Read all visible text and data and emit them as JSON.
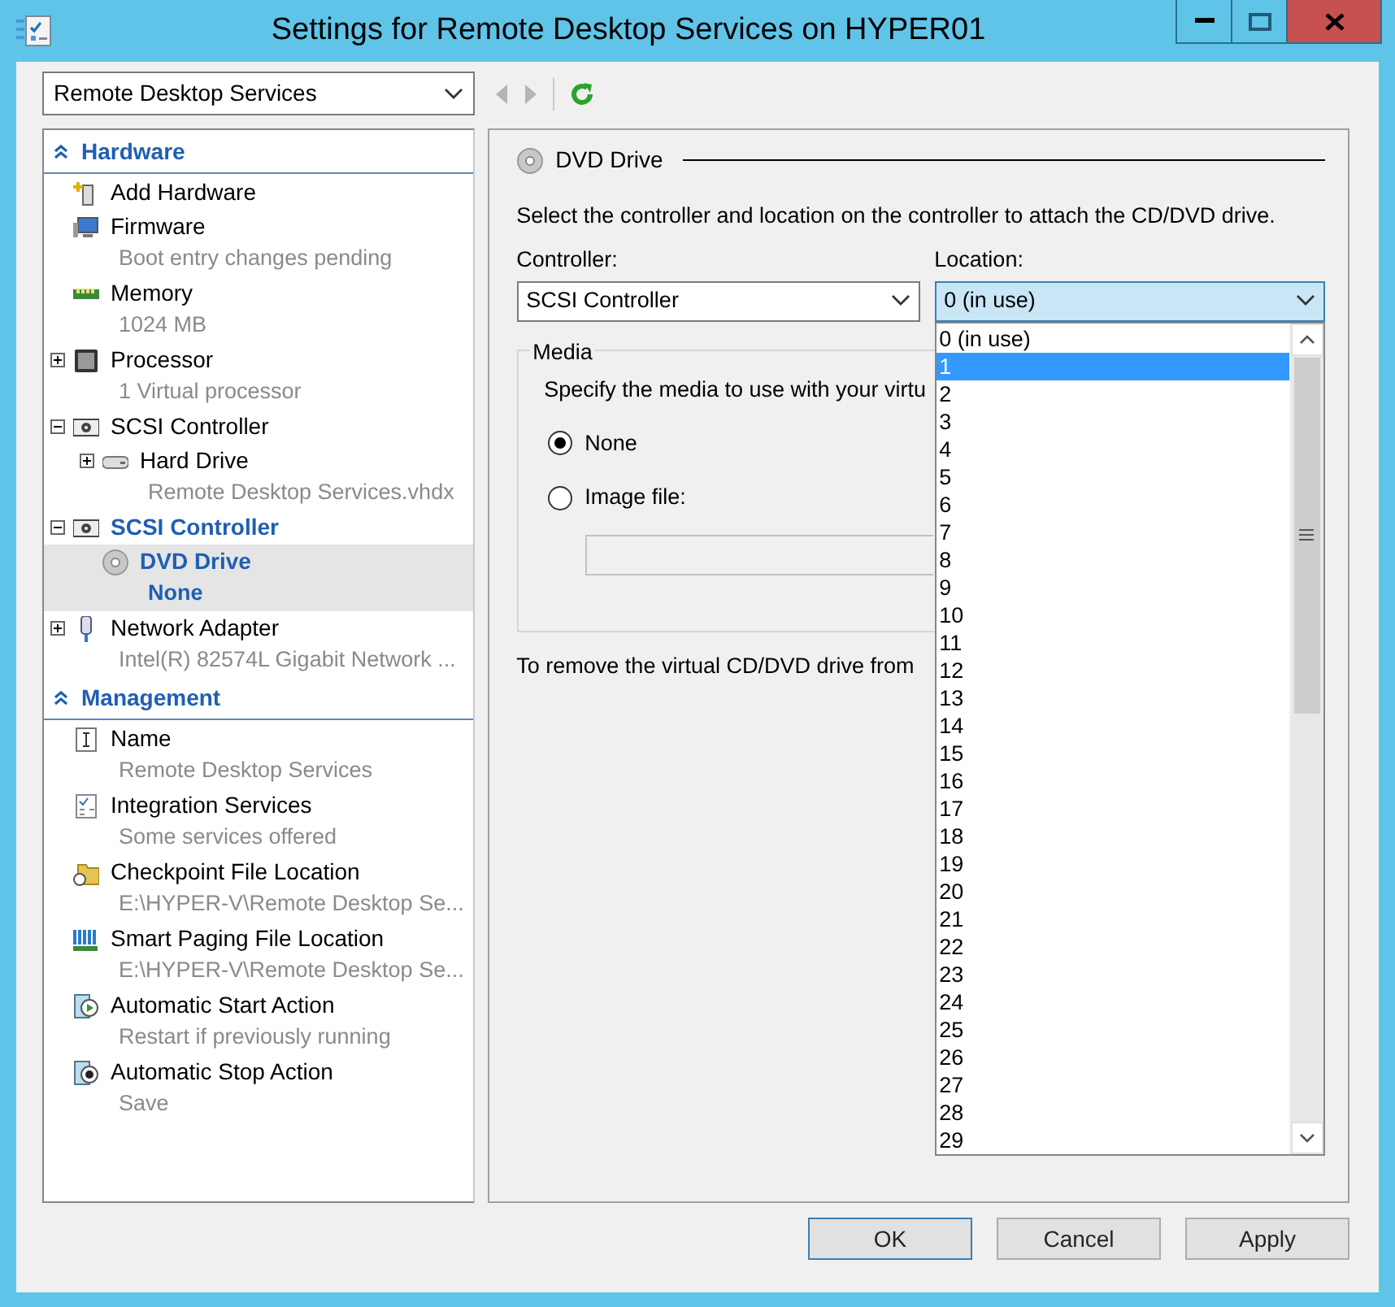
{
  "window": {
    "title": "Settings for Remote Desktop Services on HYPER01"
  },
  "vm_selector": {
    "value": "Remote Desktop Services"
  },
  "toolbar": [
    {
      "kind": "back",
      "disabled": true
    },
    {
      "kind": "forward",
      "disabled": true
    },
    {
      "kind": "refresh",
      "disabled": false
    }
  ],
  "tree": {
    "sections": [
      {
        "title": "Hardware",
        "expanded": true,
        "items": [
          {
            "title": "Add Hardware",
            "kind": "add",
            "selected": false
          },
          {
            "title": "Firmware",
            "subtitle": "Boot entry changes pending",
            "kind": "firmware",
            "selected": false
          },
          {
            "title": "Memory",
            "subtitle": "1024 MB",
            "kind": "memory",
            "selected": false
          },
          {
            "title": "Processor",
            "subtitle": "1 Virtual processor",
            "kind": "processor",
            "expanded": false,
            "selected": false
          },
          {
            "title": "SCSI Controller",
            "kind": "controller",
            "expanded": true,
            "selected": false,
            "children": [
              {
                "title": "Hard Drive",
                "subtitle": "Remote Desktop Services.vhdx",
                "kind": "disk",
                "expanded": false,
                "selected": false
              }
            ]
          },
          {
            "title": "SCSI Controller",
            "kind": "controller",
            "expanded": true,
            "selected": false,
            "children": [
              {
                "title": "DVD Drive",
                "subtitle": "None",
                "kind": "dvd",
                "selected": true
              }
            ]
          },
          {
            "title": "Network Adapter",
            "subtitle": "Intel(R) 82574L Gigabit Network ...",
            "kind": "network",
            "expanded": false,
            "selected": false
          }
        ]
      },
      {
        "title": "Management",
        "expanded": true,
        "items": [
          {
            "title": "Name",
            "subtitle": "Remote Desktop Services",
            "kind": "name",
            "selected": false
          },
          {
            "title": "Integration Services",
            "subtitle": "Some services offered",
            "kind": "integration",
            "selected": false
          },
          {
            "title": "Checkpoint File Location",
            "subtitle": "E:\\HYPER-V\\Remote Desktop Se...",
            "kind": "checkpoint",
            "selected": false
          },
          {
            "title": "Smart Paging File Location",
            "subtitle": "E:\\HYPER-V\\Remote Desktop Se...",
            "kind": "paging",
            "selected": false
          },
          {
            "title": "Automatic Start Action",
            "subtitle": "Restart if previously running",
            "kind": "start",
            "selected": false
          },
          {
            "title": "Automatic Stop Action",
            "subtitle": "Save",
            "kind": "stop",
            "selected": false
          }
        ]
      }
    ]
  },
  "panel": {
    "title": "DVD Drive",
    "intro": "Select the controller and location on the controller to attach the CD/DVD drive.",
    "controller": {
      "label": "Controller:",
      "value": "SCSI Controller"
    },
    "location": {
      "label": "Location:",
      "value": "0 (in use)",
      "expanded": true,
      "options": [
        {
          "label": "0 (in use)",
          "highlighted": false
        },
        {
          "label": "1",
          "highlighted": true
        },
        {
          "label": "2",
          "highlighted": false
        },
        {
          "label": "3",
          "highlighted": false
        },
        {
          "label": "4",
          "highlighted": false
        },
        {
          "label": "5",
          "highlighted": false
        },
        {
          "label": "6",
          "highlighted": false
        },
        {
          "label": "7",
          "highlighted": false
        },
        {
          "label": "8",
          "highlighted": false
        },
        {
          "label": "9",
          "highlighted": false
        },
        {
          "label": "10",
          "highlighted": false
        },
        {
          "label": "11",
          "highlighted": false
        },
        {
          "label": "12",
          "highlighted": false
        },
        {
          "label": "13",
          "highlighted": false
        },
        {
          "label": "14",
          "highlighted": false
        },
        {
          "label": "15",
          "highlighted": false
        },
        {
          "label": "16",
          "highlighted": false
        },
        {
          "label": "17",
          "highlighted": false
        },
        {
          "label": "18",
          "highlighted": false
        },
        {
          "label": "19",
          "highlighted": false
        },
        {
          "label": "20",
          "highlighted": false
        },
        {
          "label": "21",
          "highlighted": false
        },
        {
          "label": "22",
          "highlighted": false
        },
        {
          "label": "23",
          "highlighted": false
        },
        {
          "label": "24",
          "highlighted": false
        },
        {
          "label": "25",
          "highlighted": false
        },
        {
          "label": "26",
          "highlighted": false
        },
        {
          "label": "27",
          "highlighted": false
        },
        {
          "label": "28",
          "highlighted": false
        },
        {
          "label": "29",
          "highlighted": false
        }
      ]
    },
    "media": {
      "title": "Media",
      "instruction": "Specify the media to use with your virtu",
      "options": [
        {
          "label": "None",
          "selected": true
        },
        {
          "label": "Image file:",
          "selected": false
        }
      ]
    },
    "remove_note": "To remove the virtual CD/DVD drive from"
  },
  "buttons": [
    {
      "label": "OK",
      "default": true
    },
    {
      "label": "Cancel",
      "default": false
    },
    {
      "label": "Apply",
      "default": false
    }
  ]
}
